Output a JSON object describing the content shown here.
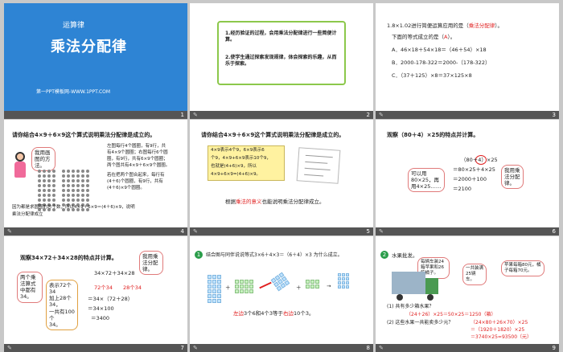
{
  "slides": [
    {
      "number": "1",
      "tag": "运算律",
      "title": "乘法分配律",
      "footer": "第一PPT模板网-WWW.1PPT.COM"
    },
    {
      "number": "2",
      "goal1": "1.经历验证的过程，会用乘法分配律进行一些简便计算。",
      "goal2": "2.使学生通过探索发现规律，体会探索的乐趣，从而乐于探索。"
    },
    {
      "number": "3",
      "q1a": "1.8×1.02进行简便运算应用的是（",
      "q1ans": "乘法分配律",
      "q1b": "）。",
      "q2a": "下面的等式成立的是（",
      "q2ans": "A",
      "q2b": "）。",
      "optA": "A．46×18＋54×18＝（46＋54）×18",
      "optB": "B．2000-178-322＝2000-（178-322）",
      "optC": "C．（37＋125）×8＝37×125×8"
    },
    {
      "number": "4",
      "header": "请你结合4×9＋6×9这个算式说明乘法分配律是成立的。",
      "bubble": "我用画图的方法。",
      "desc1": "左图每行4个圆圈，有9行，共",
      "desc2": "有4×9个圆圈；右图每行6个圆",
      "desc3": "圈，有9行，共有6×9个圆圈；",
      "desc4": "两个图共有4×9＋6×9个圆圈。",
      "desc5": "若在把两个图合起来，每行有",
      "desc6": "(4＋6)个圆圈，有9行，共有",
      "desc7": "(4＋6)×9个圆圈。",
      "conc1": "因为都是求圆圈的总个数，所以4×9＋6×9＝(4＋6)×9，说明",
      "conc2": "乘法分配律成立"
    },
    {
      "number": "5",
      "header": "请你结合4×9＋6×9这个算式说明乘法分配律是成立的。",
      "note1": "4×9表示4个9，6×9表示6",
      "note2": "个9，4×9+6×9表示10个9，",
      "note3": "也就是(4+6)×9，所以",
      "note4": "4×9+6×9=(4+6)×9。",
      "pre": "根据",
      "hl": "乘法的意义",
      "post": "也能说明乘法分配律成立。"
    },
    {
      "number": "6",
      "header": "观察（80＋4）×25的特点并计算。",
      "bubbleL": "可以用80×25，再用4×25……",
      "l1": "（80＋4）×25",
      "l2": "＝80×25＋4×25",
      "l3": "＝2000＋100",
      "l4": "＝2100",
      "bubbleR": "我用乘法分配律。"
    },
    {
      "number": "7",
      "header": "观察34×72＋34×28的特点并计算。",
      "bubbleL": "两个乘法算式中都有34。",
      "bubbleTR": "我用乘法分配律。",
      "expr": "34×72＋34×28",
      "mid1": "表示72个34",
      "mid2": "加上28个34，",
      "mid3": "一共有100个",
      "mid4": "34。",
      "a72": "72个34",
      "a28": "28个34",
      "s1": "＝34×（72＋28）",
      "s2": "＝34×100",
      "s3": "＝3400"
    },
    {
      "number": "8",
      "badge": "1",
      "header": "结合图与同伴说说等式3×6＋4×3＝（6＋4）×3 为什么成立。",
      "left": "左边",
      "mid": "3个6和4个3等于",
      "right": "右边",
      "end": "10个3。"
    },
    {
      "number": "9",
      "badge": "2",
      "header": "水果批发。",
      "b1": "每辆车装24箱苹果和26箱橘子。",
      "b2": "一共装满25辆车。",
      "b3": "苹果每箱80元，橘子每箱70元。",
      "q1": "(1) 共有多少箱水果？",
      "a1a": "（24＋26）×25＝50×25＝1250（箱）",
      "q2": "(2) 这些水果一共能卖多少元？",
      "a2a": "（24×80＋26×70）×25",
      "a2b": "＝（1920＋1820）×25",
      "a2c": "＝3740×25=93500（元）"
    }
  ]
}
